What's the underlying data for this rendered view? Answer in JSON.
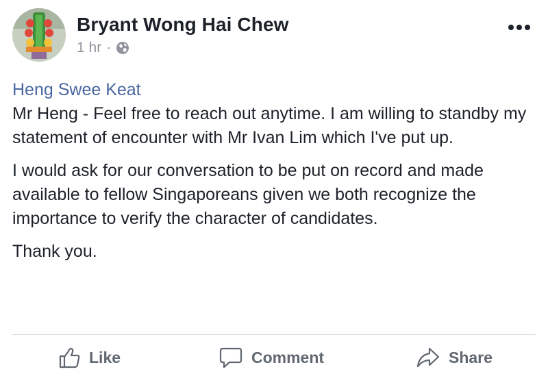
{
  "post": {
    "author": "Bryant Wong Hai Chew",
    "time": "1 hr",
    "separator": "·",
    "audience_icon": "globe-icon",
    "avatar_icon": "profile-photo",
    "more_icon": "ellipsis-icon"
  },
  "content": {
    "mention": "Heng Swee Keat",
    "paragraphs": [
      "Mr Heng - Feel free to reach out anytime. I am willing to standby my statement of encounter with Mr Ivan Lim which I've put up.",
      "I would ask for our conversation to be put on record and made available to fellow Singaporeans given we both recognize the importance to verify the character of candidates.",
      "Thank you."
    ]
  },
  "actions": {
    "like": "Like",
    "comment": "Comment",
    "share": "Share"
  },
  "colors": {
    "mention": "#4b67a1",
    "meta": "#90949c",
    "action": "#606770",
    "text": "#1d2129"
  }
}
